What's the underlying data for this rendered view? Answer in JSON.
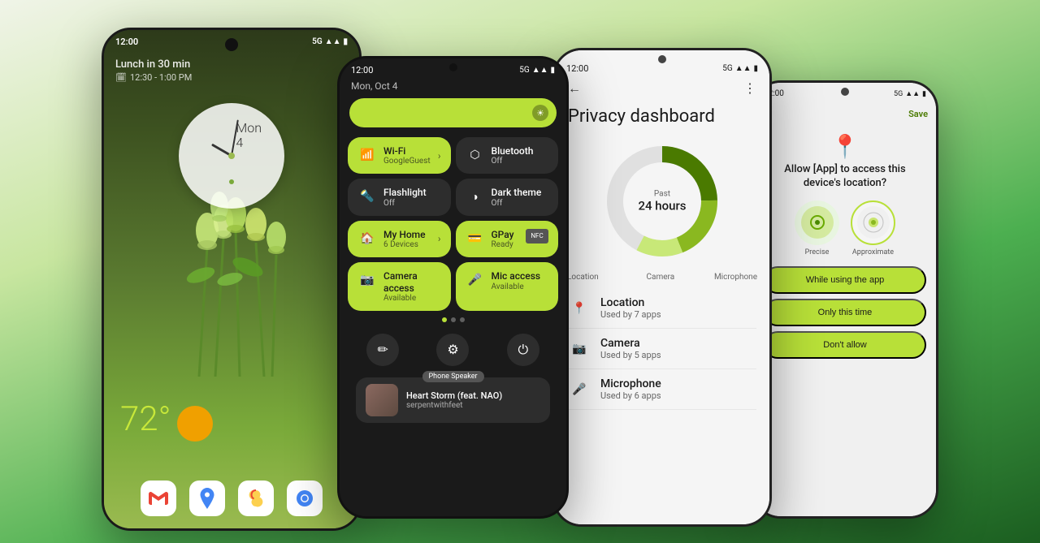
{
  "background": {
    "color_start": "#e8f5e0",
    "color_end": "#2e7d32"
  },
  "phone1": {
    "status_time": "12:00",
    "status_signal": "5G",
    "event_title": "Lunch in 30 min",
    "event_time": "12:30 - 1:00 PM",
    "clock_date": "Mon 4",
    "temperature": "72°",
    "apps": [
      "Gmail",
      "Maps",
      "Photos",
      "Chrome"
    ]
  },
  "phone2": {
    "status_time": "12:00",
    "status_signal": "5G",
    "date_label": "Mon, Oct 4",
    "tiles": [
      {
        "name": "Wi-Fi",
        "sub": "GoogleGuest",
        "active": true,
        "icon": "📶"
      },
      {
        "name": "Bluetooth",
        "sub": "Off",
        "active": false,
        "icon": "🔵"
      },
      {
        "name": "Flashlight",
        "sub": "Off",
        "active": false,
        "icon": "🔦"
      },
      {
        "name": "Dark theme",
        "sub": "Off",
        "active": false,
        "icon": "🌙"
      },
      {
        "name": "My Home",
        "sub": "6 Devices",
        "active": true,
        "icon": "🏠"
      },
      {
        "name": "GPay",
        "sub": "Ready",
        "active": true,
        "icon": "💳"
      },
      {
        "name": "Camera access",
        "sub": "Available",
        "active": true,
        "icon": "📷"
      },
      {
        "name": "Mic access",
        "sub": "Available",
        "active": true,
        "icon": "🎤"
      }
    ],
    "bottom_icons": [
      "✏️",
      "⚙️",
      "⏻"
    ],
    "media_badge": "Phone Speaker",
    "media_title": "Heart Storm (feat. NAO)",
    "media_artist": "serpentwithfeet"
  },
  "phone3": {
    "status_time": "12:00",
    "status_signal": "5G",
    "title": "Privacy dashboard",
    "chart_center_label": "Past",
    "chart_center_value": "24 hours",
    "chart_labels": [
      "Location",
      "Camera",
      "Microphone"
    ],
    "privacy_items": [
      {
        "name": "Location",
        "sub": "Used by 7 apps",
        "icon": "📍"
      },
      {
        "name": "Camera",
        "sub": "Used by 5 apps",
        "icon": "📷"
      },
      {
        "name": "Microphone",
        "sub": "Used by 6 apps",
        "icon": "🎤"
      }
    ]
  },
  "phone4": {
    "status_time": "12:00",
    "status_signal": "5G",
    "save_label": "Save",
    "title": "Allow [App] to access this device's location?",
    "option_precise": "Precise",
    "option_approx": "Approximate",
    "btn_while_using": "While using the app",
    "btn_once": "Only this time",
    "btn_deny": "Don't allow"
  }
}
